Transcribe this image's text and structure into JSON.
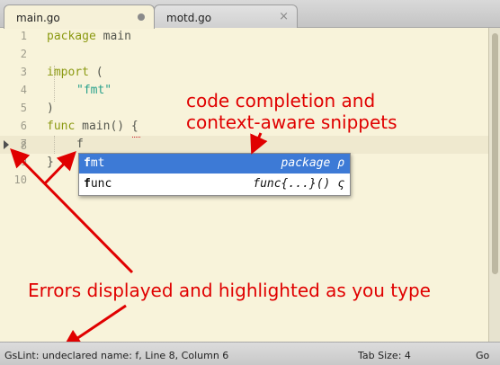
{
  "tabs": [
    {
      "label": "main.go",
      "active": true,
      "indicator": "dirty-dot"
    },
    {
      "label": "motd.go",
      "active": false,
      "indicator": "×"
    }
  ],
  "gutter": [
    "1",
    "2",
    "3",
    "4",
    "5",
    "6",
    "7",
    "8",
    "9",
    "10"
  ],
  "code": {
    "line1_kw": "package",
    "line1_rest": " main",
    "line3_kw": "import",
    "line3_rest": " (",
    "line4_str": "\"fmt\"",
    "line5": ")",
    "line7_kw": "func",
    "line7_rest": " main() {",
    "line8": "f",
    "line9": "}"
  },
  "completion": {
    "items": [
      {
        "name_bold": "f",
        "name_rest": "mt",
        "hint": "package ρ"
      },
      {
        "name_bold": "f",
        "name_rest": "unc",
        "hint": "func{...}() ς"
      }
    ]
  },
  "annotations": {
    "completion_note_line1": "code completion and",
    "completion_note_line2": "context-aware snippets",
    "errors_note": "Errors displayed and highlighted as you type"
  },
  "statusbar": {
    "message": "GsLint: undeclared name: f, Line 8, Column 6",
    "tab_size": "Tab Size: 4",
    "syntax": "Go"
  },
  "colors": {
    "annotation": "#e00000",
    "selection": "#3d7ad6",
    "editor_bg": "#f8f3da"
  }
}
